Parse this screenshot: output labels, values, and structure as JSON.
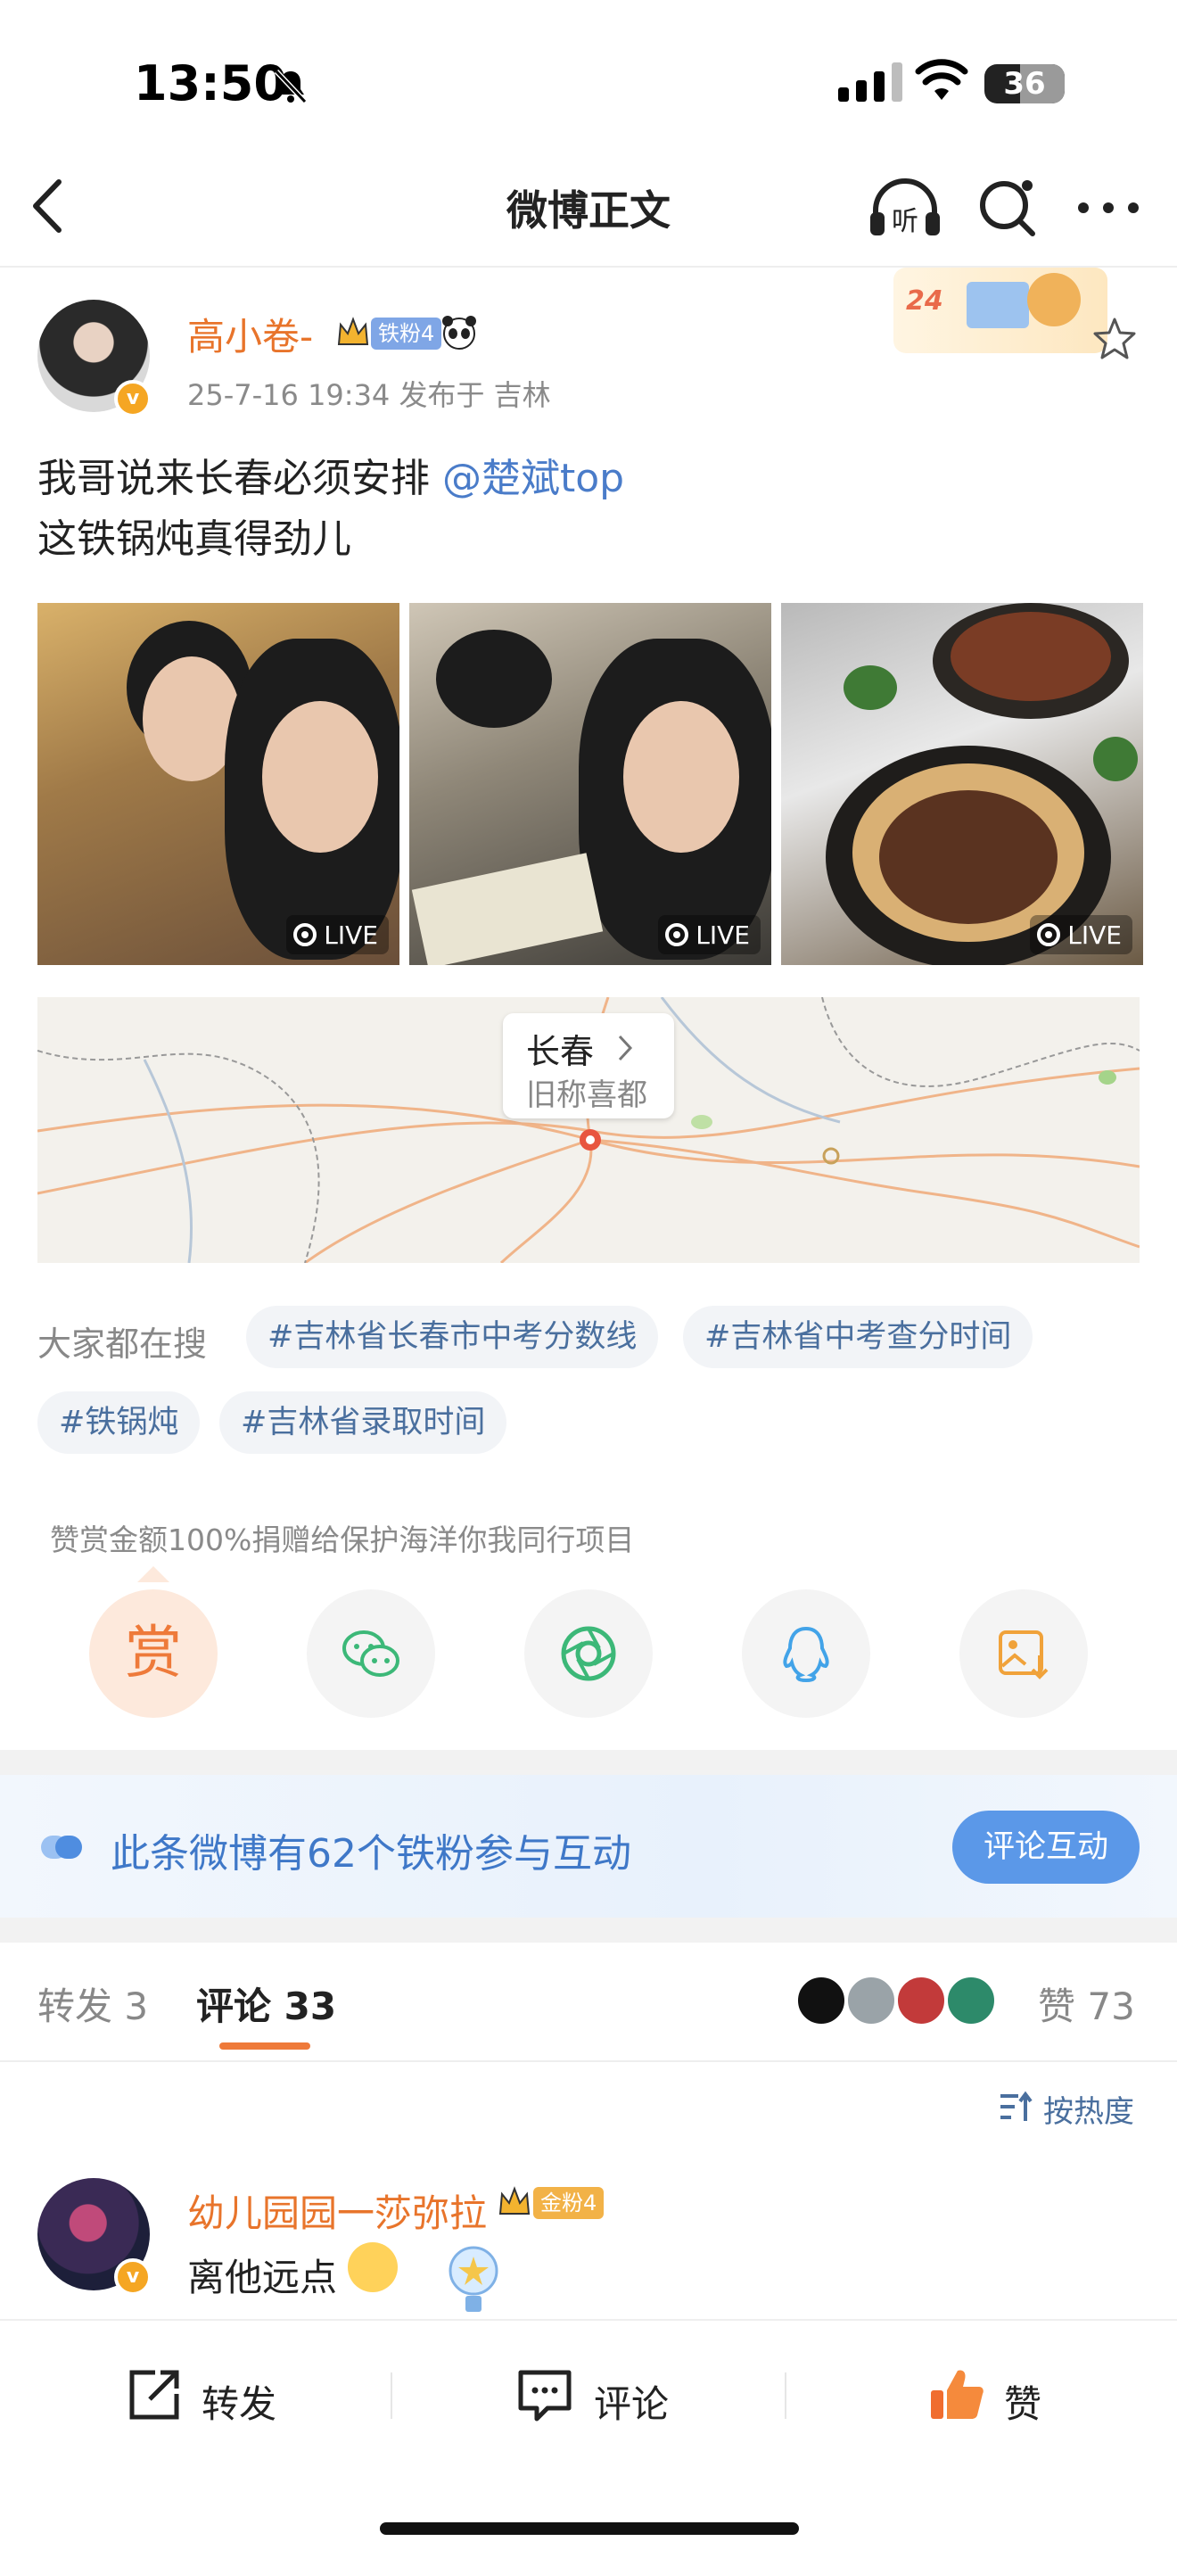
{
  "status_bar": {
    "time": "13:50",
    "battery": "36"
  },
  "nav": {
    "title": "微博正文"
  },
  "post": {
    "username": "高小卷-",
    "fan_badge": "铁粉4",
    "meta": "25-7-16 19:34  发布于 吉林",
    "deco_text": "24",
    "text_line1_prefix": "我哥说来长春必须安排",
    "mention": "@楚斌top",
    "text_line2": "这铁锅炖真得劲儿",
    "images": [
      {
        "label": "LIVE"
      },
      {
        "label": "LIVE"
      },
      {
        "label": "LIVE"
      }
    ]
  },
  "map": {
    "city": "长春",
    "subtitle": "旧称喜都"
  },
  "search": {
    "label": "大家都在搜",
    "tags": [
      "#吉林省长春市中考分数线",
      "#吉林省中考查分时间",
      "#铁锅炖",
      "#吉林省录取时间"
    ]
  },
  "reward": {
    "note": "赞赏金额100%捐赠给保护海洋你我同行项目",
    "button": "赏"
  },
  "share_icons": [
    "reward-icon",
    "wechat-icon",
    "moments-icon",
    "qq-icon",
    "save-image-icon"
  ],
  "fans_banner": {
    "text": "此条微博有62个铁粉参与互动",
    "button": "评论互动"
  },
  "tabs": {
    "repost": "转发 3",
    "comments": "评论 33",
    "likes": "赞 73"
  },
  "sort": {
    "label": "按热度"
  },
  "comment": {
    "username": "幼儿园园一莎弥拉",
    "badge": "金粉4",
    "text": "离他远点"
  },
  "bottom_bar": {
    "repost": "转发",
    "comment": "评论",
    "like": "赞"
  },
  "colors": {
    "accent": "#ee7a3a",
    "link": "#4a7cc9",
    "username": "#e8742b",
    "banner_button": "#5b98e8"
  }
}
